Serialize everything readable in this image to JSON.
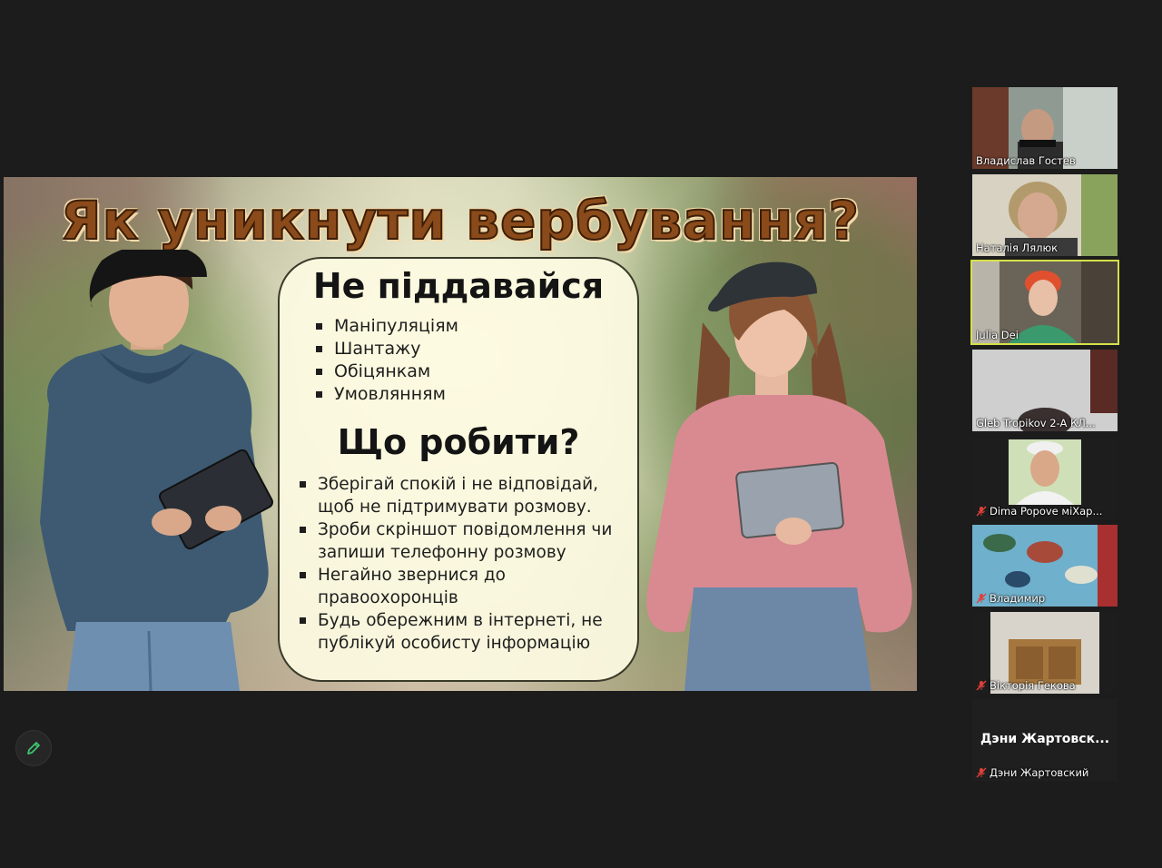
{
  "slide": {
    "title": "Як уникнути вербування?",
    "section_dont": {
      "heading": "Не піддавайся",
      "items": [
        "Маніпуляціям",
        "Шантажу",
        "Обіцянкам",
        "Умовлянням"
      ]
    },
    "section_what": {
      "heading": "Що робити?",
      "items": [
        "Зберігай спокій і не відповідай, щоб не підтримувати розмову.",
        "Зроби скріншот повідомлення чи запиши телефонну розмову",
        "Негайно звернися до правоохоронців",
        "Будь обережним в інтернеті, не публікуй особисту інформацію"
      ]
    }
  },
  "participants": [
    {
      "name": "Владислав Гостев",
      "muted": false,
      "active": false
    },
    {
      "name": "Наталія Лялюк",
      "muted": false,
      "active": false
    },
    {
      "name": "Julia Dei",
      "muted": false,
      "active": true
    },
    {
      "name": "Gleb Tropikov  2-A   КЛ...",
      "muted": false,
      "active": false
    },
    {
      "name": "Dima Popove  міХар...",
      "muted": true,
      "active": false
    },
    {
      "name": "Владимир",
      "muted": true,
      "active": false
    },
    {
      "name": "Вікторія Гекова",
      "muted": true,
      "active": false
    },
    {
      "name": "Дэни Жартовский",
      "muted": true,
      "active": false,
      "no_video_label": "Дэни  Жартовск..."
    }
  ],
  "colors": {
    "active_speaker": "#d6e04a",
    "mic_off": "#e0403a",
    "pen": "#3ec46d"
  }
}
